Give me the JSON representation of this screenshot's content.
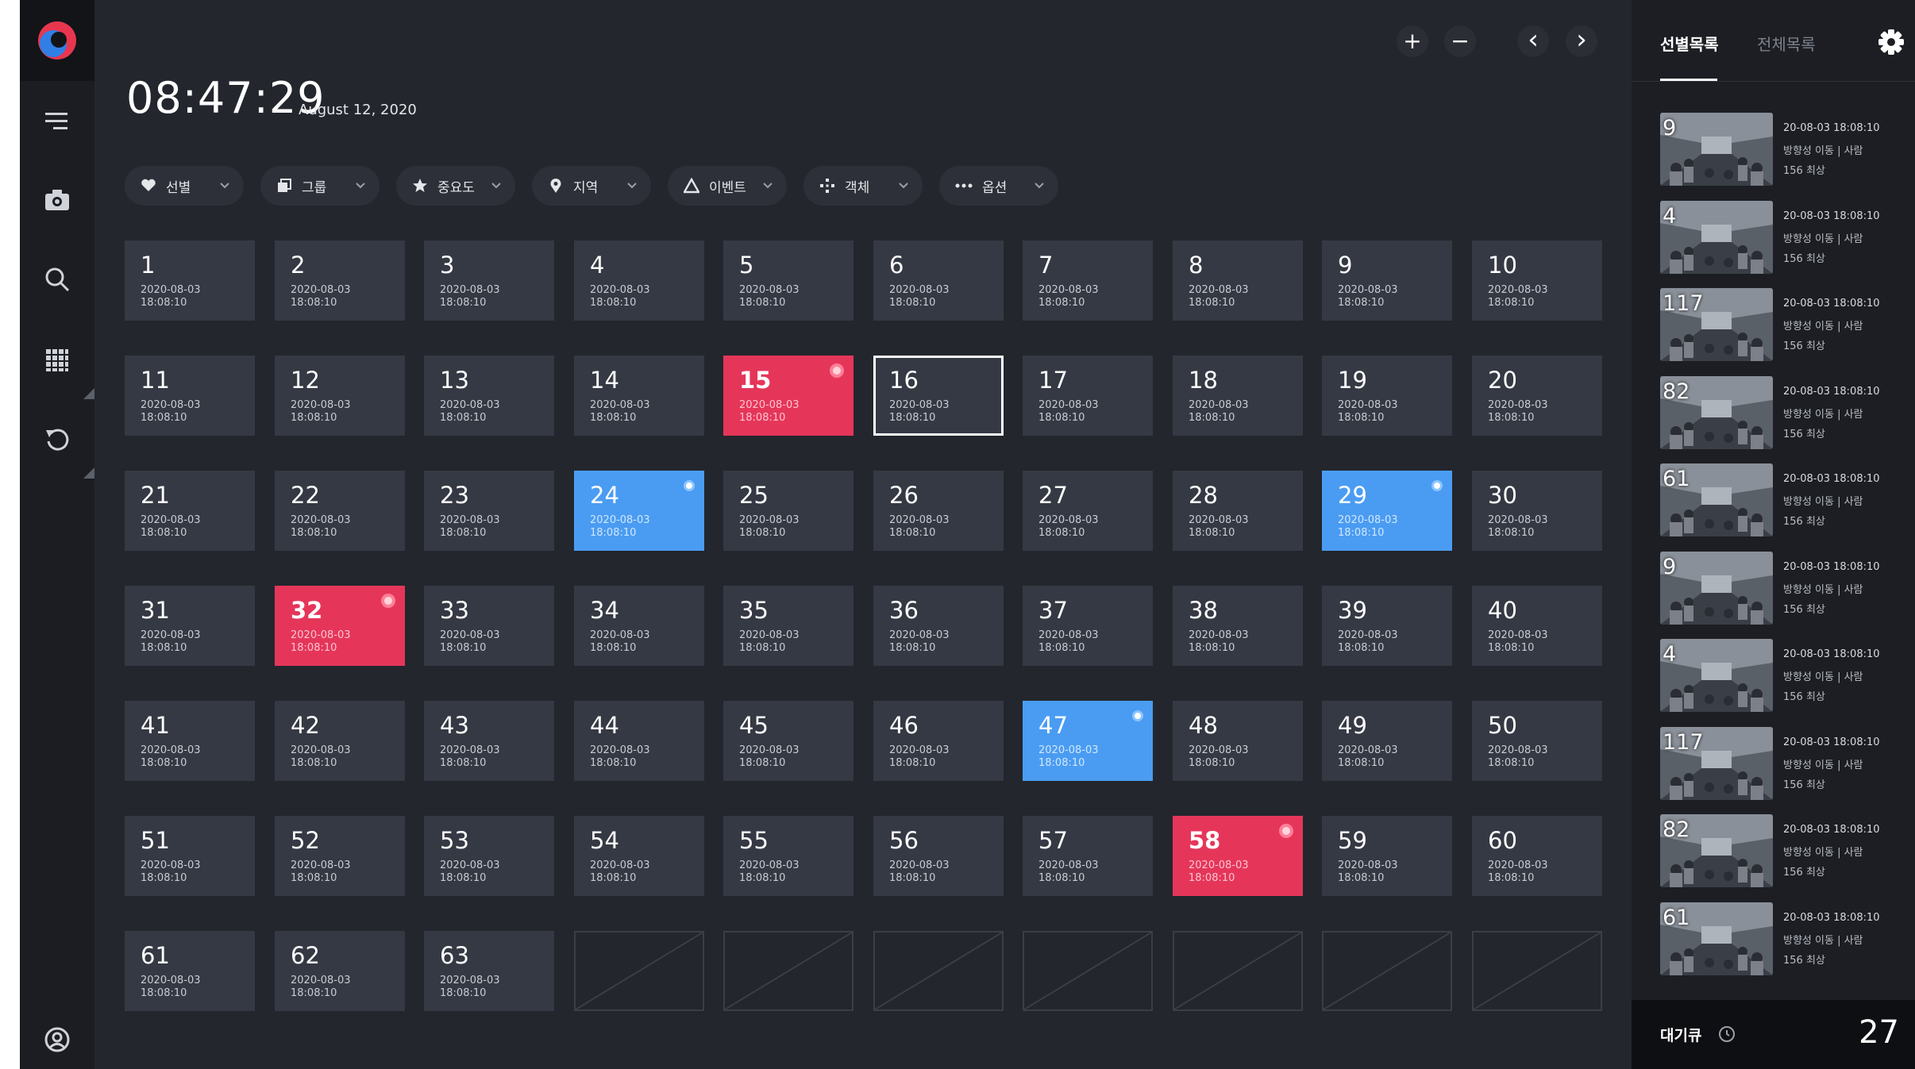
{
  "time": "08:47:29",
  "date": "August 12, 2020",
  "toolbar": {
    "zoom_in": "+",
    "zoom_out": "−",
    "prev": "‹",
    "next": "›"
  },
  "filters": [
    {
      "label": "선별",
      "icon": "heart-icon"
    },
    {
      "label": "그룹",
      "icon": "group-icon"
    },
    {
      "label": "중요도",
      "icon": "star-icon"
    },
    {
      "label": "지역",
      "icon": "location-icon"
    },
    {
      "label": "이벤트",
      "icon": "warning-icon"
    },
    {
      "label": "객체",
      "icon": "object-icon"
    },
    {
      "label": "옵션",
      "icon": "more-icon"
    }
  ],
  "cell_date": "2020-08-03",
  "cell_time": "18:08:10",
  "cells_total": 63,
  "grid_slots": 70,
  "red_cells": [
    15,
    32,
    58
  ],
  "blue_cells": [
    24,
    29,
    47
  ],
  "selected_cell": 16,
  "colors": {
    "red": "#e5365a",
    "blue": "#4a9cf2",
    "tile": "#353943",
    "background": "#23262d"
  },
  "panel": {
    "tab_selected": "선별목록",
    "tab_all": "전체목록",
    "items": [
      {
        "num": "9",
        "time": "20-08-03 18:08:10",
        "motion": "방향성 이동 | 사람",
        "level": "156 최상"
      },
      {
        "num": "4",
        "time": "20-08-03 18:08:10",
        "motion": "방향성 이동 | 사람",
        "level": "156 최상"
      },
      {
        "num": "117",
        "time": "20-08-03 18:08:10",
        "motion": "방향성 이동 | 사람",
        "level": "156 최상"
      },
      {
        "num": "82",
        "time": "20-08-03 18:08:10",
        "motion": "방향성 이동 | 사람",
        "level": "156 최상"
      },
      {
        "num": "61",
        "time": "20-08-03 18:08:10",
        "motion": "방향성 이동 | 사람",
        "level": "156 최상"
      },
      {
        "num": "9",
        "time": "20-08-03 18:08:10",
        "motion": "방향성 이동 | 사람",
        "level": "156 최상"
      },
      {
        "num": "4",
        "time": "20-08-03 18:08:10",
        "motion": "방향성 이동 | 사람",
        "level": "156 최상"
      },
      {
        "num": "117",
        "time": "20-08-03 18:08:10",
        "motion": "방향성 이동 | 사람",
        "level": "156 최상"
      },
      {
        "num": "82",
        "time": "20-08-03 18:08:10",
        "motion": "방향성 이동 | 사람",
        "level": "156 최상"
      },
      {
        "num": "61",
        "time": "20-08-03 18:08:10",
        "motion": "방향성 이동 | 사람",
        "level": "156 최상"
      }
    ],
    "queue_label": "대기큐",
    "queue_count": "27"
  }
}
